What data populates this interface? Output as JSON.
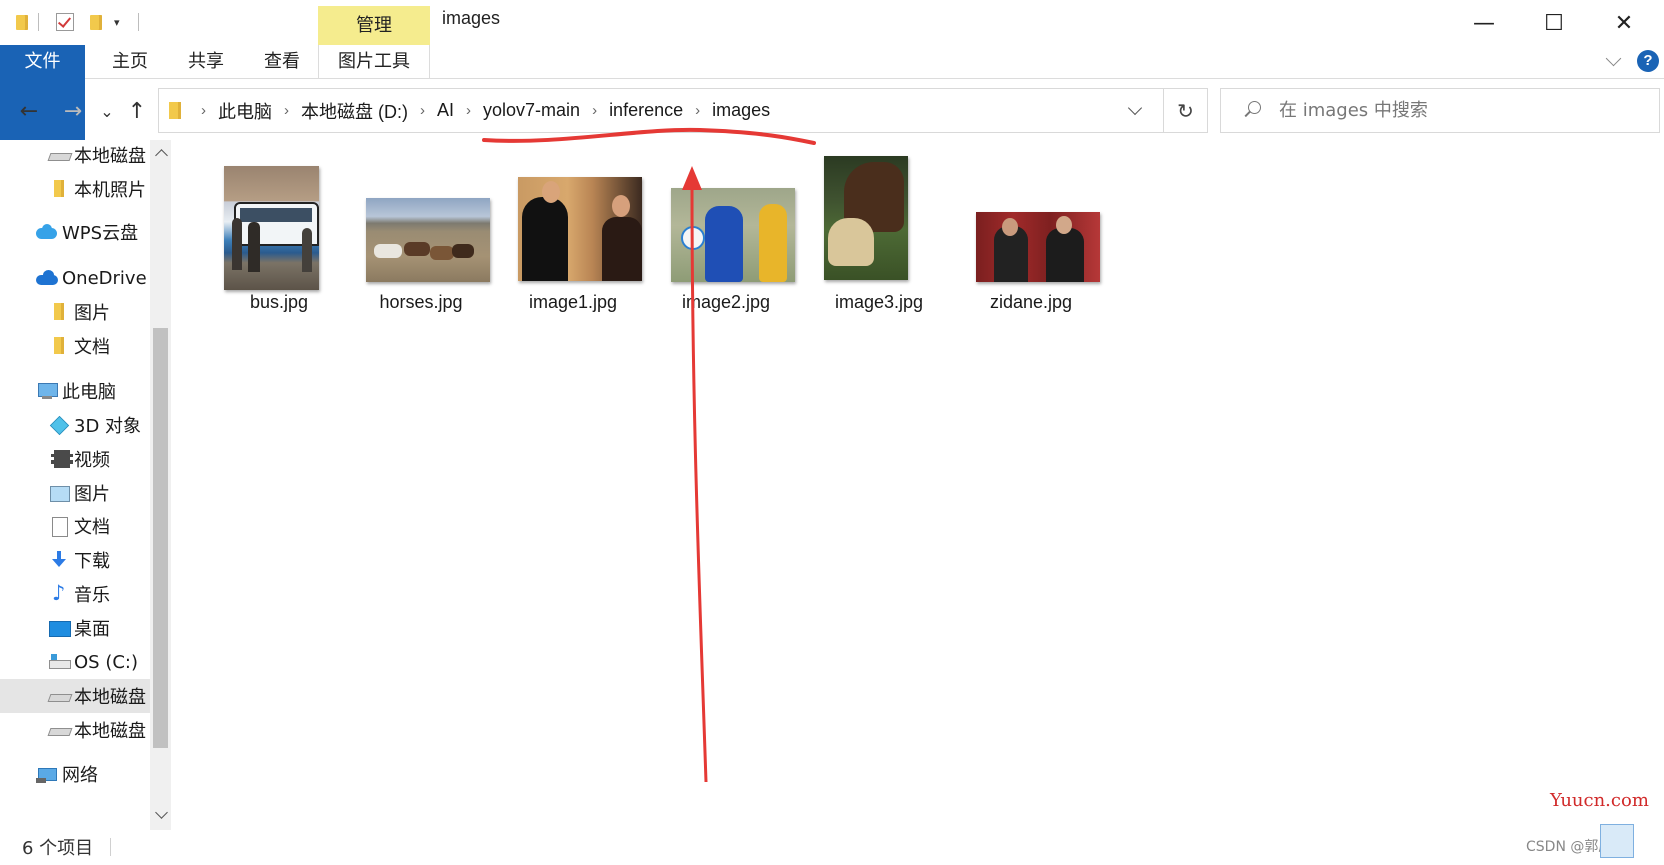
{
  "window": {
    "title": "images",
    "manage_tab": "管理",
    "minimize_icon": "—",
    "maximize_icon": "☐",
    "close_icon": "✕"
  },
  "ribbon": {
    "tabs": [
      "文件",
      "主页",
      "共享",
      "查看",
      "图片工具"
    ],
    "help_label": "?"
  },
  "nav": {
    "back_icon": "←",
    "forward_icon": "→",
    "recent_icon": "⌄",
    "up_icon": "↑",
    "refresh_icon": "↻"
  },
  "breadcrumb": [
    "此电脑",
    "本地磁盘 (D:)",
    "AI",
    "yolov7-main",
    "inference",
    "images"
  ],
  "search": {
    "placeholder": "在 images 中搜索"
  },
  "sidebar": {
    "items": [
      {
        "label": "本地磁盘",
        "icon": "drive-icon"
      },
      {
        "label": "本机照片",
        "icon": "folder-icon"
      },
      {
        "label": "WPS云盘",
        "icon": "cloud-icon"
      },
      {
        "label": "OneDrive",
        "icon": "onedrive-icon"
      },
      {
        "label": "图片",
        "icon": "folder-icon"
      },
      {
        "label": "文档",
        "icon": "folder-icon"
      },
      {
        "label": "此电脑",
        "icon": "computer-icon"
      },
      {
        "label": "3D 对象",
        "icon": "cube-icon"
      },
      {
        "label": "视频",
        "icon": "video-icon"
      },
      {
        "label": "图片",
        "icon": "pictures-icon"
      },
      {
        "label": "文档",
        "icon": "document-icon"
      },
      {
        "label": "下载",
        "icon": "download-icon"
      },
      {
        "label": "音乐",
        "icon": "music-icon"
      },
      {
        "label": "桌面",
        "icon": "desktop-icon"
      },
      {
        "label": "OS (C:)",
        "icon": "os-drive-icon"
      },
      {
        "label": "本地磁盘",
        "icon": "drive-icon",
        "selected": true
      },
      {
        "label": "本地磁盘",
        "icon": "drive-icon"
      },
      {
        "label": "网络",
        "icon": "network-icon"
      }
    ]
  },
  "files": [
    {
      "name": "bus.jpg",
      "thumb": "bus"
    },
    {
      "name": "horses.jpg",
      "thumb": "horses"
    },
    {
      "name": "image1.jpg",
      "thumb": "people"
    },
    {
      "name": "image2.jpg",
      "thumb": "soccer"
    },
    {
      "name": "image3.jpg",
      "thumb": "horse-dog"
    },
    {
      "name": "zidane.jpg",
      "thumb": "men-in-suits"
    }
  ],
  "status": {
    "item_count": "6 个项目"
  },
  "watermark": {
    "site": "Yuucn.com",
    "source": "CSDN @郭庆汝"
  },
  "colors": {
    "file_tab": "#1a63b5",
    "manage_tab": "#f5ec8e",
    "annotation": "#e53935",
    "selected_row": "#e5e5e5"
  }
}
